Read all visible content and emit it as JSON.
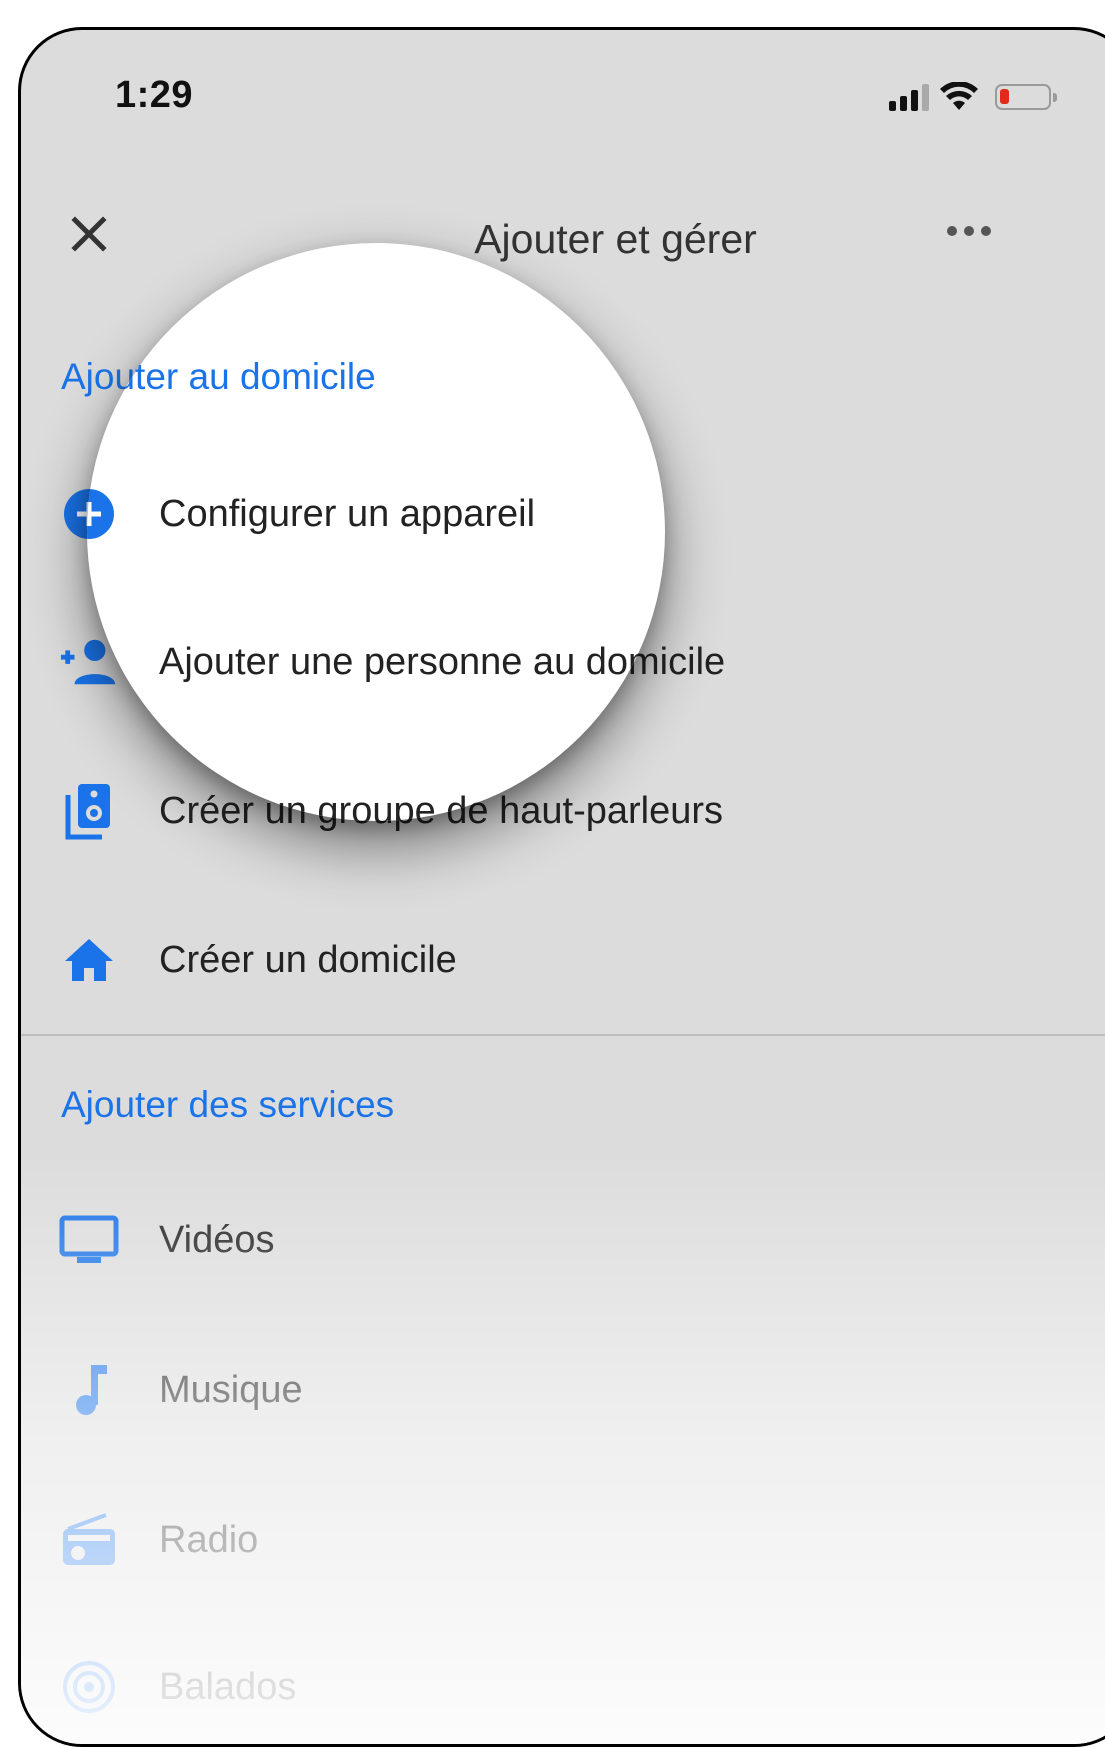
{
  "status": {
    "time": "1:29"
  },
  "appbar": {
    "title": "Ajouter et gérer"
  },
  "sections": {
    "home": {
      "header": "Ajouter au domicile",
      "items": [
        {
          "label": "Configurer un appareil",
          "icon": "add-circle-icon"
        },
        {
          "label": "Ajouter une personne au domicile",
          "icon": "person-add-icon"
        },
        {
          "label": "Créer un groupe de haut-parleurs",
          "icon": "speaker-group-icon"
        },
        {
          "label": "Créer un domicile",
          "icon": "home-icon"
        }
      ]
    },
    "services": {
      "header": "Ajouter des services",
      "items": [
        {
          "label": "Vidéos",
          "icon": "tv-icon"
        },
        {
          "label": "Musique",
          "icon": "music-note-icon"
        },
        {
          "label": "Radio",
          "icon": "radio-icon"
        },
        {
          "label": "Balados",
          "icon": "podcast-icon"
        }
      ]
    }
  },
  "colors": {
    "accent": "#1a73e8",
    "background": "#dcdcdc",
    "battery_low": "#e12a1a"
  }
}
